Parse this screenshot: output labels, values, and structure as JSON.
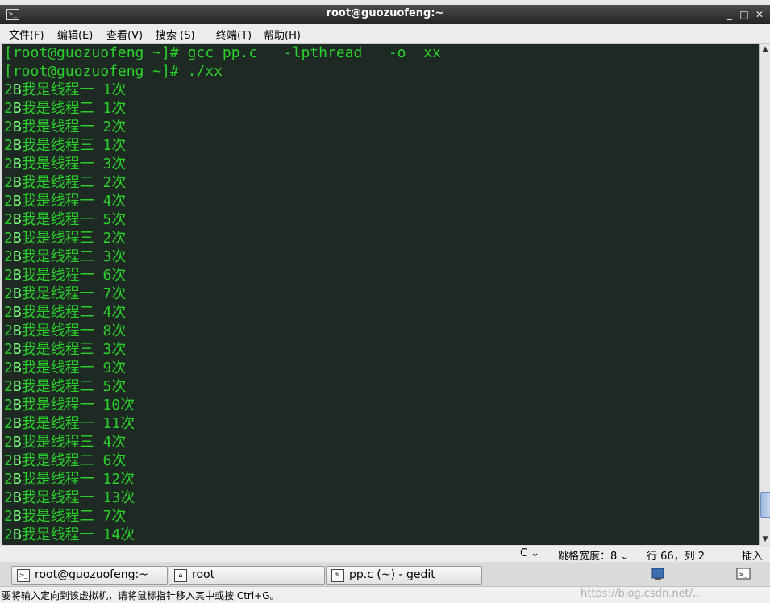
{
  "window": {
    "title": "root@guozuofeng:~"
  },
  "menu": [
    "文件(F)",
    "编辑(E)",
    "查看(V)",
    "搜索 (S)",
    "终端(T)",
    "帮助(H)"
  ],
  "terminal": {
    "prompts": [
      {
        "prompt": "[root@guozuofeng ~]#",
        "command": " gcc pp.c   -lpthread   -o  xx"
      },
      {
        "prompt": "[root@guozuofeng ~]#",
        "command": " ./xx"
      }
    ],
    "output": [
      "我是线程一 1次",
      "我是线程二 1次",
      "我是线程一 2次",
      "我是线程三 1次",
      "我是线程一 3次",
      "我是线程二 2次",
      "我是线程一 4次",
      "我是线程一 5次",
      "我是线程三 2次",
      "我是线程二 3次",
      "我是线程一 6次",
      "我是线程一 7次",
      "我是线程二 4次",
      "我是线程一 8次",
      "我是线程三 3次",
      "我是线程一 9次",
      "我是线程二 5次",
      "我是线程一 10次",
      "我是线程一 11次",
      "我是线程三 4次",
      "我是线程二 6次",
      "我是线程一 12次",
      "我是线程一 13次",
      "我是线程二 7次",
      "我是线程一 14次"
    ],
    "output_prefix_digit": "2",
    "output_prefix_bold": "B"
  },
  "gedit_status": {
    "language": "C",
    "tab_width": "跳格宽度：8",
    "position": "行 66，列 2",
    "mode": "插入"
  },
  "taskbar": {
    "tasks": [
      "root@guozuofeng:~",
      "root",
      "pp.c (~) - gedit"
    ]
  },
  "hint": {
    "text": "要将输入定向到该虚拟机，请将鼠标指针移入其中或按 Ctrl+G。",
    "watermark": "https://blog.csdn.net/..."
  },
  "colors": {
    "terminal_bg": "#1e2923",
    "terminal_fg": "#2bd12b",
    "titlebar": "#333333"
  }
}
